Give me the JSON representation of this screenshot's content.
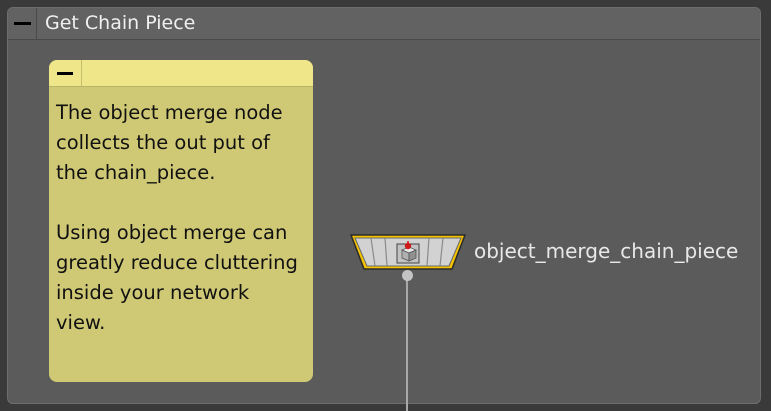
{
  "network_box": {
    "title": "Get Chain Piece",
    "collapse_icon": "minus-icon"
  },
  "sticky_note": {
    "collapse_icon": "minus-icon",
    "text": "The object merge node\ncollects the out put of\nthe chain_piece.\n\nUsing object merge can\ngreatly reduce cluttering\ninside your network\nview."
  },
  "node": {
    "label": "object_merge_chain_piece",
    "icon": "object-merge-icon",
    "selected": true
  },
  "colors": {
    "network_box_bg": "#5b5b5b",
    "sticky_bg": "#cfc975",
    "sticky_header": "#efe68a",
    "node_highlight": "#f2c200"
  }
}
